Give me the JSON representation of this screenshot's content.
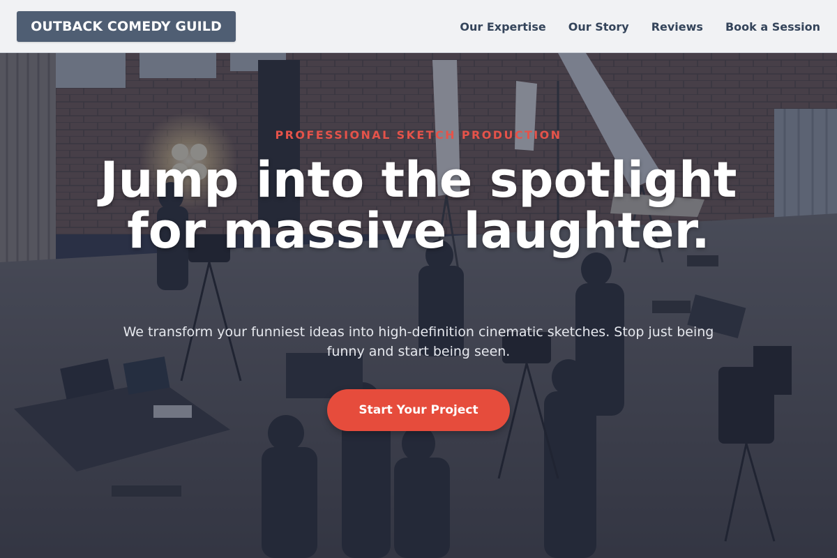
{
  "header": {
    "logo_text": "OUTBACK COMEDY GUILD",
    "nav": [
      {
        "label": "Our Expertise"
      },
      {
        "label": "Our Story"
      },
      {
        "label": "Reviews"
      },
      {
        "label": "Book a Session"
      }
    ]
  },
  "hero": {
    "eyebrow": "PROFESSIONAL SKETCH PRODUCTION",
    "headline": "Jump into the spotlight for massive laughter.",
    "subtext": "We transform your funniest ideas into high-definition cinematic sketches. Stop just being funny and start being seen.",
    "cta_label": "Start Your Project",
    "background": "film crew working in a brick-walled warehouse studio"
  },
  "colors": {
    "header_bg": "#f1f2f4",
    "logo_bg": "#4f5e73",
    "nav_text": "#34445a",
    "accent": "#e64c3c",
    "overlay": "#2a3248"
  }
}
